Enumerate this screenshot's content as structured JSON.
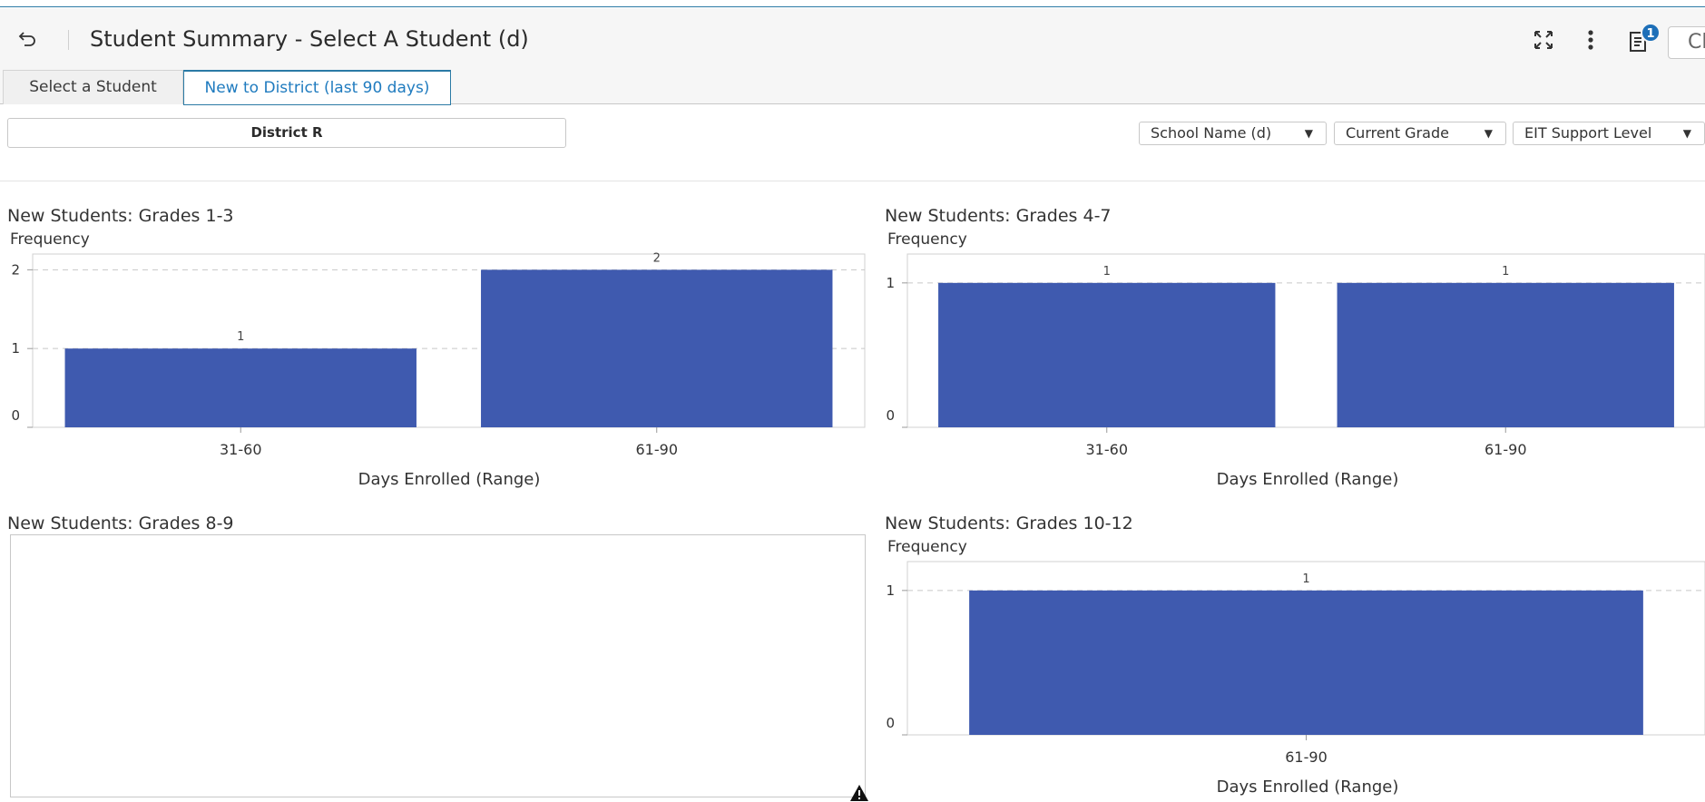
{
  "header": {
    "title": "Student Summary - Select A Student (d)",
    "notification_count": "1",
    "close_label": "Close"
  },
  "tabs": [
    {
      "label": "Select a Student",
      "active": false
    },
    {
      "label": "New to District (last 90 days)",
      "active": true
    }
  ],
  "filters": {
    "district": "District R",
    "dropdowns": [
      {
        "label": "School Name (d)"
      },
      {
        "label": "Current Grade"
      },
      {
        "label": "EIT Support Level"
      }
    ]
  },
  "colors": {
    "bar": "#3f5aaf",
    "accent": "#2b7aa5",
    "badge": "#1d6fb8"
  },
  "chart_data": [
    {
      "type": "bar",
      "title": "New Students: Grades 1-3",
      "ylabel": "Frequency",
      "xlabel": "Days Enrolled (Range)",
      "categories": [
        "31-60",
        "61-90"
      ],
      "values": [
        1,
        2
      ],
      "ylim": [
        0,
        2.2
      ],
      "yticks": [
        0,
        1,
        2
      ],
      "grid": true
    },
    {
      "type": "bar",
      "title": "New Students: Grades 4-7",
      "ylabel": "Frequency",
      "xlabel": "Days Enrolled (Range)",
      "categories": [
        "31-60",
        "61-90"
      ],
      "values": [
        1,
        1
      ],
      "ylim": [
        0,
        1.2
      ],
      "yticks": [
        0,
        1
      ],
      "grid": true
    },
    {
      "type": "bar",
      "title": "New Students: Grades 8-9",
      "ylabel": "",
      "xlabel": "",
      "categories": [],
      "values": [],
      "empty": true
    },
    {
      "type": "bar",
      "title": "New Students: Grades 10-12",
      "ylabel": "Frequency",
      "xlabel": "Days Enrolled (Range)",
      "categories": [
        "61-90"
      ],
      "values": [
        1
      ],
      "ylim": [
        0,
        1.2
      ],
      "yticks": [
        0,
        1
      ],
      "grid": true
    }
  ]
}
